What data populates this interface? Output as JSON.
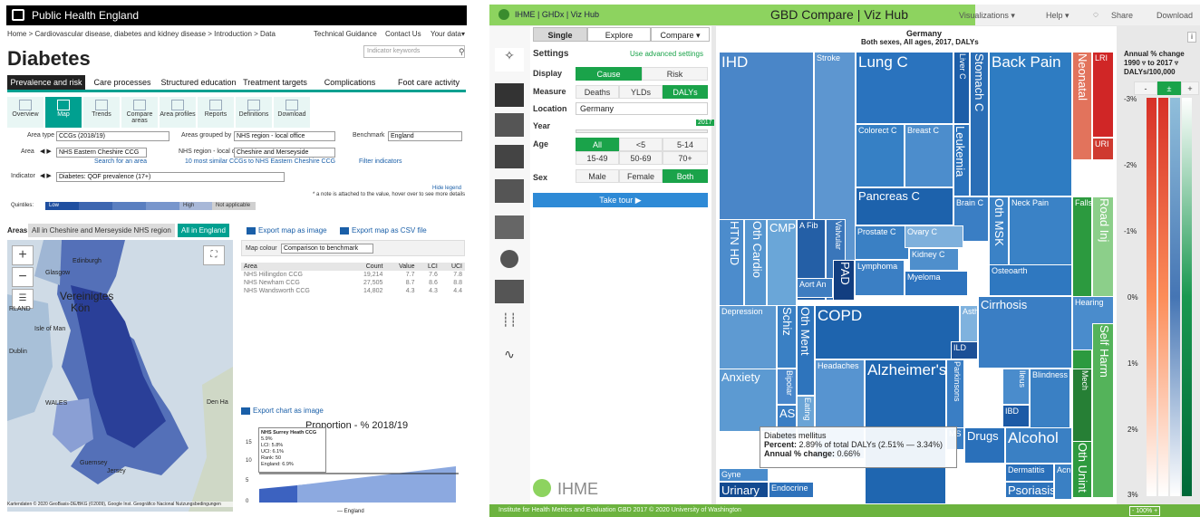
{
  "phe": {
    "top_title": "Public Health England",
    "breadcrumb": "Home > Cardiovascular disease, diabetes and kidney disease > Introduction > Data",
    "top_links": [
      "Technical Guidance",
      "Contact Us",
      "Your data▾"
    ],
    "title": "Diabetes",
    "indicator_placeholder": "Indicator keywords",
    "tabs": [
      "Prevalence and risk",
      "Care processes",
      "Structured education",
      "Treatment targets",
      "Complications",
      "Foot care activity"
    ],
    "tools": [
      "Overview",
      "Map",
      "Trends",
      "Compare areas",
      "Area profiles",
      "Reports",
      "Definitions",
      "Download"
    ],
    "area_type_label": "Area type",
    "area_type_value": "CCGs (2018/19)",
    "grouped_label": "Areas grouped by",
    "grouped_value": "NHS region - local office",
    "benchmark_label": "Benchmark",
    "benchmark_value": "England",
    "area_label": "Area",
    "area_value": "NHS Eastern Cheshire CCG",
    "region_label": "NHS region - local office",
    "region_value": "Cheshire and Merseyside",
    "search_link": "Search for an area",
    "similar_link": "10 most similar CCGs to NHS Eastern Cheshire CCG",
    "filter_link": "Filter indicators",
    "indicator_label": "Indicator",
    "indicator_value": "Diabetes: QOF prevalence (17+)",
    "hide_legend": "Hide legend",
    "note": "* a note is attached to the value, hover over to see more details",
    "quintiles_label": "Quintiles:",
    "quintiles": [
      "Low",
      "High",
      "Not applicable"
    ],
    "areas_label": "Areas",
    "areas_tab1": "All in Cheshire and Merseyside NHS region",
    "areas_tab2": "All in England",
    "export_map_image": "Export map as image",
    "export_map_csv": "Export map as CSV file",
    "map_colour_label": "Map colour",
    "map_colour_value": "Comparison to benchmark",
    "table_headers": [
      "Area",
      "Count",
      "Value",
      "LCI",
      "UCI"
    ],
    "table_rows": [
      [
        "NHS Hillingdon CCG",
        "19,214",
        "7.7",
        "7.6",
        "7.8"
      ],
      [
        "NHS Newham CCG",
        "27,505",
        "8.7",
        "8.6",
        "8.8"
      ],
      [
        "NHS Wandsworth CCG",
        "14,802",
        "4.3",
        "4.3",
        "4.4"
      ]
    ],
    "map_labels": [
      "Edinburgh",
      "Glasgow",
      "Vereinigtes",
      "Kön",
      "RLAND",
      "Isle of Man",
      "Dublin",
      "WALES",
      "Den Ha",
      "Guernsey",
      "Jersey"
    ],
    "map_attrib": "Kartendaten © 2020 GeoBasis-DE/BKG (©2009), Google Inst. Geográfico Nacional   Nutzungsbedingungen",
    "export_chart": "Export chart as image",
    "chart_title": "Proportion - % 2018/19",
    "chart_yticks": [
      "15",
      "10",
      "5",
      "0"
    ],
    "tooltip": [
      "NHS Surrey Heath CCG",
      "5.9%",
      "LCI: 5.8%",
      "UCI: 6.1%",
      "Rank: 50",
      "England: 6.9%"
    ],
    "legend_england": "England",
    "quintile_colors": [
      "#1f4fa0",
      "#3d66b0",
      "#5a7fc0",
      "#7896cc",
      "#d0d0d0"
    ]
  },
  "ihme": {
    "brand": "IHME | GHDx | Viz Hub",
    "title": "GBD Compare | Viz Hub",
    "nav": [
      "Visualizations ▾",
      "Help ▾",
      "Share",
      "Download"
    ],
    "tabs": [
      "Single",
      "Explore",
      "Compare ▾"
    ],
    "settings": "Settings",
    "advanced": "Use advanced settings",
    "display_label": "Display",
    "display_opts": [
      "Cause",
      "Risk"
    ],
    "measure_label": "Measure",
    "measure_opts": [
      "Deaths",
      "YLDs",
      "DALYs"
    ],
    "location_label": "Location",
    "location_value": "Germany",
    "year_label": "Year",
    "year_value": "2017",
    "age_label": "Age",
    "age_opts": [
      "All",
      "<5",
      "5-14",
      "15-49",
      "50-69",
      "70+"
    ],
    "sex_label": "Sex",
    "sex_opts": [
      "Male",
      "Female",
      "Both"
    ],
    "tour": "Take tour ▶",
    "logo": "IHME",
    "chart_title1": "Germany",
    "chart_title2": "Both sexes, All ages, 2017, DALYs",
    "info": "i",
    "legend_title1": "Annual % change",
    "legend_title2": "1990 ▿ to 2017 ▿",
    "legend_title3": "DALYs/100,000",
    "legend_btns": [
      "-",
      "±",
      "+"
    ],
    "legend_ticks": [
      "-3%",
      "-2%",
      "-1%",
      "0%",
      "1%",
      "2%",
      "3%"
    ],
    "tooltip_title": "Diabetes mellitus",
    "tooltip_pct_label": "Percent:",
    "tooltip_pct": "2.89% of total DALYs (2.51% — 3.34%)",
    "tooltip_chg_label": "Annual % change:",
    "tooltip_chg": "0.66%",
    "footer": "Institute for Health Metrics and Evaluation     GBD 2017     © 2020 University of Washington",
    "footer_zoom": "100%",
    "tiles": [
      {
        "label": "IHD",
        "color": "#4a86c8"
      },
      {
        "label": "Stroke",
        "color": "#5d96d0"
      },
      {
        "label": "Lung C",
        "color": "#2a73be"
      },
      {
        "label": "Liver C",
        "color": "#1d5ea8"
      },
      {
        "label": "Stomach C",
        "color": "#2b6eb6"
      },
      {
        "label": "Back Pain",
        "color": "#2e7cc2"
      },
      {
        "label": "Neonatal",
        "color": "#e2735c"
      },
      {
        "label": "LRI",
        "color": "#d02626"
      },
      {
        "label": "URI",
        "color": "#cf3a30"
      },
      {
        "label": "Colorect C",
        "color": "#3680c5"
      },
      {
        "label": "Breast C",
        "color": "#4c8dcc"
      },
      {
        "label": "Leukemia",
        "color": "#2a72bc"
      },
      {
        "label": "Other MN",
        "color": "#3a7fc4"
      },
      {
        "label": "Pancreas C",
        "color": "#1d62ac"
      },
      {
        "label": "Brain C",
        "color": "#3a7ec4"
      },
      {
        "label": "Oth MSK",
        "color": "#3b82c6"
      },
      {
        "label": "Neck Pain",
        "color": "#3a82c6"
      },
      {
        "label": "Falls",
        "color": "#2c9a3f"
      },
      {
        "label": "Road Inj",
        "color": "#8ccf8a"
      },
      {
        "label": "HTN HD",
        "color": "#4c8ccc"
      },
      {
        "label": "Oth Cardio",
        "color": "#5696d0"
      },
      {
        "label": "CMP",
        "color": "#6aa6d8"
      },
      {
        "label": "A Fib",
        "color": "#245fa6"
      },
      {
        "label": "Valvular",
        "color": "#3a76ba"
      },
      {
        "label": "PAD",
        "color": "#123e80"
      },
      {
        "label": "Aort An",
        "color": "#3f7dc0"
      },
      {
        "label": "Prostate C",
        "color": "#3a80c4"
      },
      {
        "label": "Ovary C",
        "color": "#7eb0dc"
      },
      {
        "label": "Kidney C",
        "color": "#4f8fcc"
      },
      {
        "label": "Lymphoma",
        "color": "#3b7fc4"
      },
      {
        "label": "Myeloma",
        "color": "#2d73be"
      },
      {
        "label": "Osteoarth",
        "color": "#2f78c0"
      },
      {
        "label": "Depression",
        "color": "#5e9ad2"
      },
      {
        "label": "Schiz",
        "color": "#3a80c4"
      },
      {
        "label": "Oth Ment",
        "color": "#2e74bc"
      },
      {
        "label": "COPD",
        "color": "#1e64ae"
      },
      {
        "label": "Asthma",
        "color": "#7fb2de"
      },
      {
        "label": "ILD",
        "color": "#1c4f96"
      },
      {
        "label": "Cirrhosis",
        "color": "#3a7ec4"
      },
      {
        "label": "Hearing",
        "color": "#4a8ccc"
      },
      {
        "label": "Anxiety",
        "color": "#5c9ad2"
      },
      {
        "label": "Bipolar",
        "color": "#4a88cc"
      },
      {
        "label": "ASD",
        "color": "#3a7ec4"
      },
      {
        "label": "Eating",
        "color": "#6aa4d6"
      },
      {
        "label": "Headaches",
        "color": "#5794d0"
      },
      {
        "label": "Alzheimer's",
        "color": "#1f66b0"
      },
      {
        "label": "Parkinsons",
        "color": "#3a7ec4"
      },
      {
        "label": "Ileus",
        "color": "#4a8ccc"
      },
      {
        "label": "Blindness",
        "color": "#3a80c4"
      },
      {
        "label": "IBD",
        "color": "#1c5aa6"
      },
      {
        "label": "MS",
        "color": "#3a7ec4"
      },
      {
        "label": "Drugs",
        "color": "#2a70ba"
      },
      {
        "label": "Alcohol",
        "color": "#3a80c4"
      },
      {
        "label": "Gyne",
        "color": "#4a8ccc"
      },
      {
        "label": "Urinary",
        "color": "#134a90"
      },
      {
        "label": "Endocrine",
        "color": "#2e72bb"
      },
      {
        "label": "Dermatitis",
        "color": "#2a70ba"
      },
      {
        "label": "Acne",
        "color": "#3a80c4"
      },
      {
        "label": "Psoriasis",
        "color": "#2f74bc"
      },
      {
        "label": "Mech",
        "color": "#267f35"
      },
      {
        "label": "Oth Unint",
        "color": "#2e9a3e"
      },
      {
        "label": "Self Harm",
        "color": "#54b35a"
      }
    ],
    "gradient_colors": [
      "#d73027",
      "#fc8d59",
      "#ffffff",
      "#91bfdb",
      "#4575b4",
      "#1a9850",
      "#006837"
    ]
  }
}
